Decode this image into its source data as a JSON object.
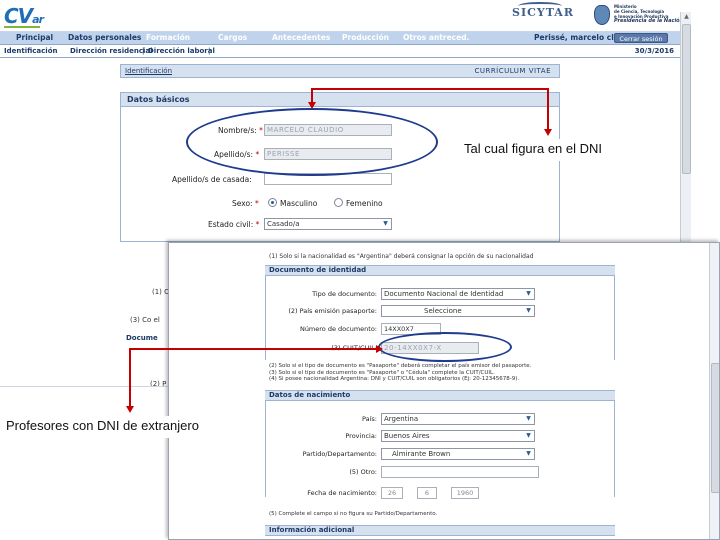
{
  "header": {
    "logo": "CV",
    "logo_sub": "ar",
    "sicytar": "SICYTAR",
    "ministry_lines": [
      "Ministerio",
      "de Ciencia, Tecnología",
      "e Innovación Productiva"
    ],
    "presidency": "Presidencia de la Nación"
  },
  "nav": {
    "tabs": [
      "Principal",
      "Datos personales",
      "Formación",
      "Cargos",
      "Antecedentes",
      "Producción",
      "Otros antreced."
    ],
    "user": "Perissé, marcelo cl",
    "logout": "Cerrar sesión"
  },
  "subnav": {
    "items": [
      "Identificación",
      "Dirección residencial",
      "Dirección laboral"
    ],
    "separators": [
      "|",
      "|"
    ],
    "date": "30/3/2016"
  },
  "form": {
    "id_bar_left": "Identificación",
    "id_bar_right": "CURRÍCULUM VITAE",
    "basic_title": "Datos básicos",
    "nombres_label": "Nombre/s:",
    "nombres_value": "MARCELO CLAUDIO",
    "apellidos_label": "Apellido/s:",
    "apellidos_value": "PERISSE",
    "casada_label": "Apellido/s de casada:",
    "sexo_label": "Sexo:",
    "sexo_options": [
      "Masculino",
      "Femenino"
    ],
    "sexo_selected": "Masculino",
    "estado_label": "Estado civil:",
    "estado_value": "Casado/a",
    "req": "*",
    "partial_1": "(1) C",
    "partial_2": "(3) Co el",
    "partial_3": "Docume",
    "partial_4": "(2) P"
  },
  "callouts": {
    "dni": "Tal cual figura en el DNI",
    "ext": "Profesores con DNI de extranjero"
  },
  "overlay": {
    "note": "(1) Solo si la nacionalidad es \"Argentina\" deberá consignar la opción de su nacionalidad",
    "doc_title": "Documento de identidad",
    "tipo_label": "Tipo de documento:",
    "tipo_value": "Documento Nacional de Identidad",
    "pais_label": "(2) País emisión pasaporte:",
    "pais_value": "Seleccione",
    "numero_label": "Número de documento:",
    "numero_value": "14XX0X7",
    "cuit_label": "(3) CUIT/CUIL:",
    "cuit_value": "20-14XX0X7-X",
    "notes": [
      "(2) Solo si el tipo de documento es \"Pasaporte\" deberá completar el país emisor del pasaporte.",
      "(3) Solo si el tipo de documento es \"Pasaporte\" o \"Cédula\" complete la CUIT/CUIL.",
      "(4) Si posee nacionalidad Argentina: DNI y CUIT/CUIL son obligatorios (Ej: 20-12345678-9)."
    ],
    "birth_title": "Datos de nacimiento",
    "birth_pais_label": "País:",
    "birth_pais_value": "Argentina",
    "birth_prov_label": "Provincia:",
    "birth_prov_value": "Buenos Aires",
    "birth_partido_label": "Partido/Departamento:",
    "birth_partido_value": "Almirante Brown",
    "birth_otro_label": "(5) Otro:",
    "birth_fecha_label": "Fecha de nacimiento:",
    "birth_day": "26",
    "birth_month": "6",
    "birth_year": "1960",
    "birth_note": "(5) Complete el campo si no figura su Partido/Departamento.",
    "info_title": "Información adicional"
  }
}
